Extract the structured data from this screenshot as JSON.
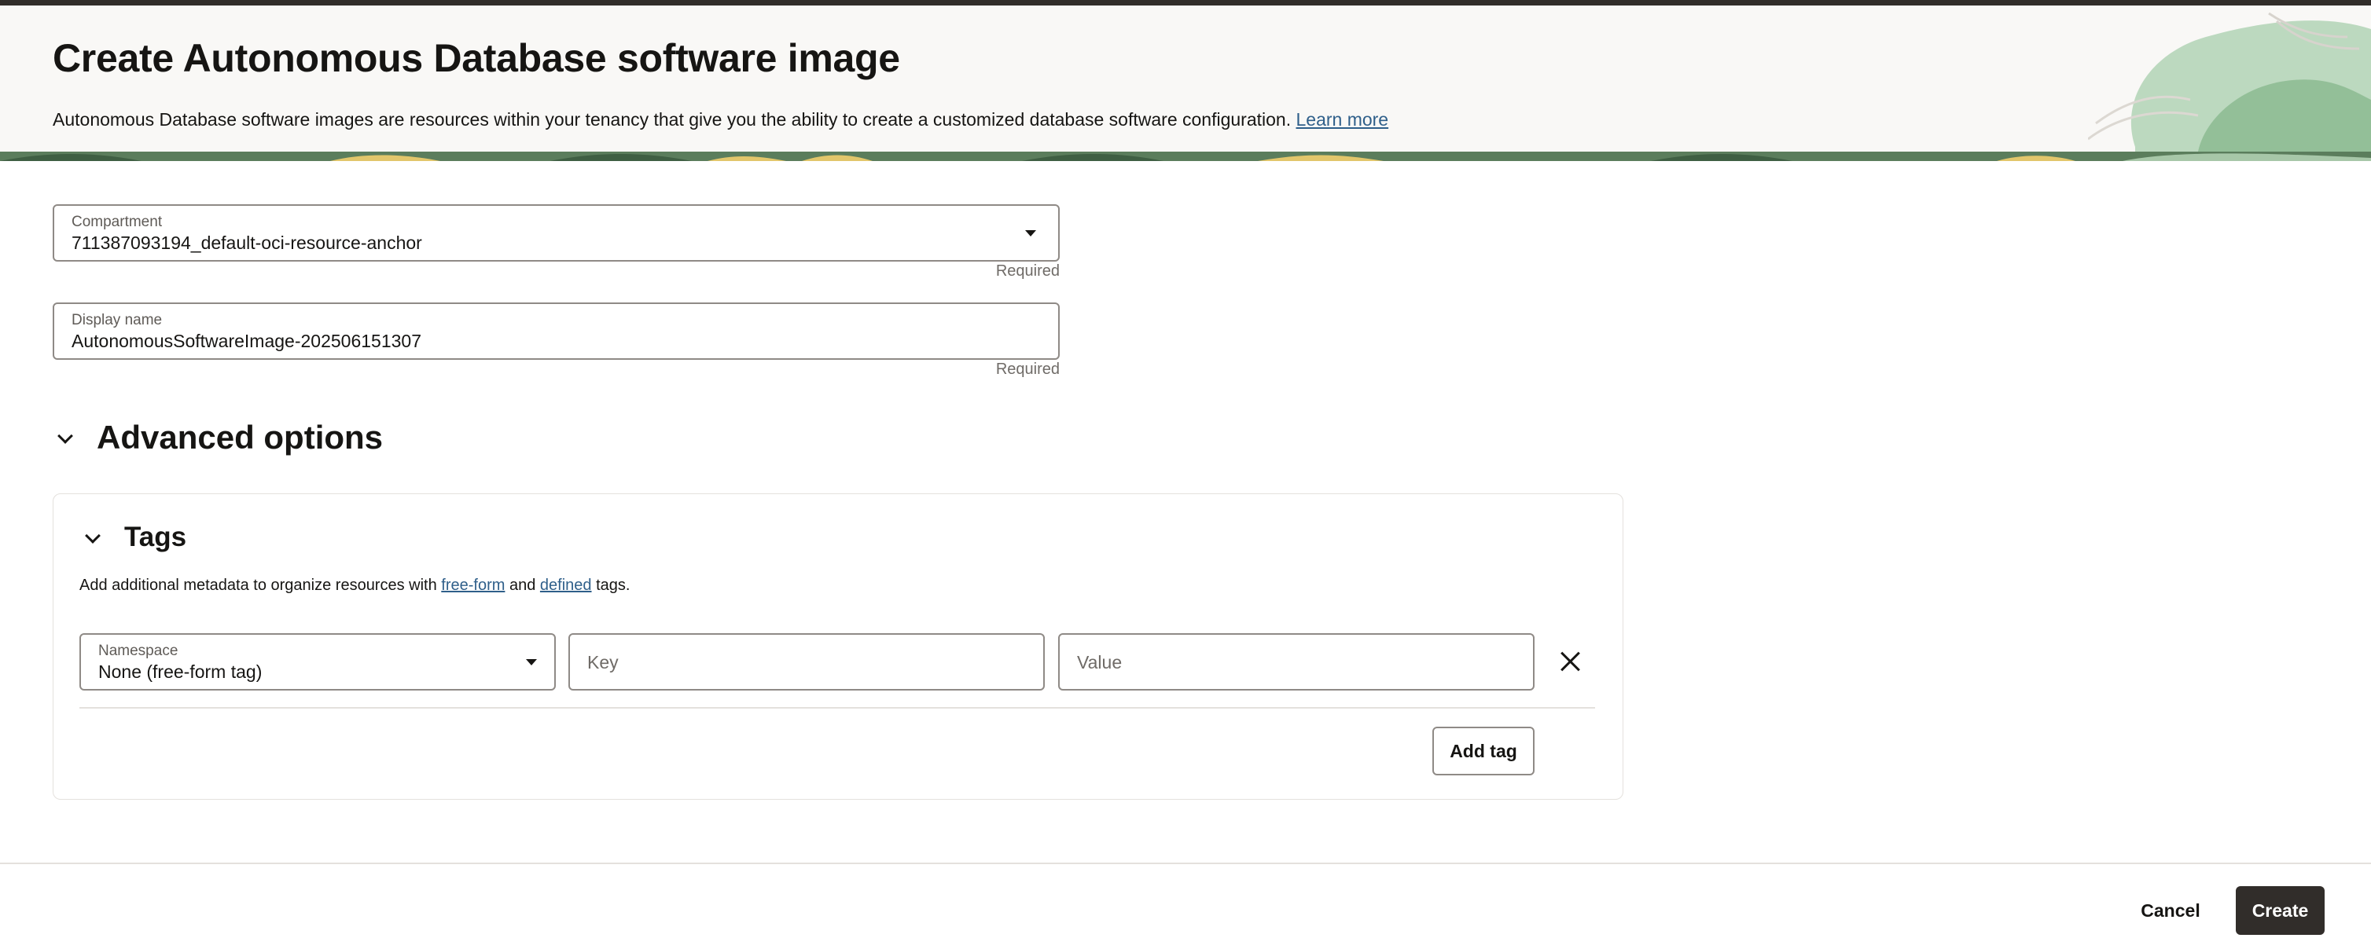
{
  "header": {
    "title": "Create Autonomous Database software image",
    "description": "Autonomous Database software images are resources within your tenancy that give you the ability to create a customized database software configuration.",
    "learn_more": "Learn more"
  },
  "form": {
    "compartment": {
      "label": "Compartment",
      "value": "711387093194_default-oci-resource-anchor",
      "helper": "Required"
    },
    "display_name": {
      "label": "Display name",
      "value": "AutonomousSoftwareImage-202506151307",
      "helper": "Required"
    }
  },
  "advanced": {
    "title": "Advanced options",
    "tags": {
      "title": "Tags",
      "desc_prefix": "Add additional metadata to organize resources with",
      "free_form_link": "free-form",
      "and": "and",
      "defined_link": "defined",
      "desc_suffix": "tags.",
      "namespace_label": "Namespace",
      "namespace_value": "None (free-form tag)",
      "key_placeholder": "Key",
      "value_placeholder": "Value",
      "add_tag": "Add tag"
    }
  },
  "footer": {
    "cancel": "Cancel",
    "create": "Create"
  },
  "colors": {
    "primary_button": "#312d2a",
    "link": "#2f5f8a",
    "header_bg": "#f9f8f6",
    "border": "#8f8a86"
  },
  "icons": [
    "chevron-down-icon",
    "caret-down-icon",
    "close-icon"
  ]
}
